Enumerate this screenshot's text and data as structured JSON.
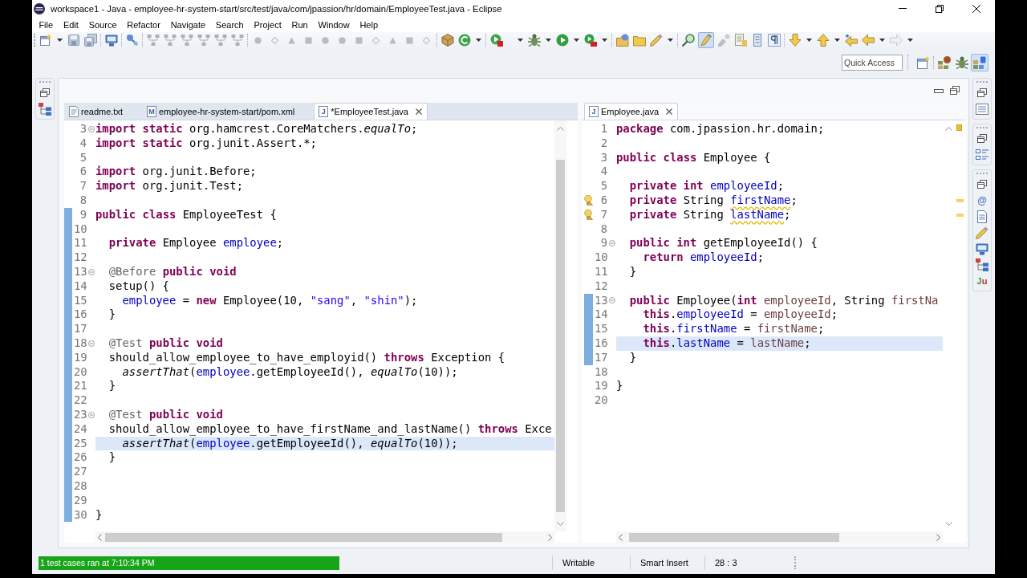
{
  "window": {
    "title": "workspace1 - Java - employee-hr-system-start/src/test/java/com/jpassion/hr/domain/EmployeeTest.java - Eclipse"
  },
  "menu": [
    "File",
    "Edit",
    "Source",
    "Refactor",
    "Navigate",
    "Search",
    "Project",
    "Run",
    "Window",
    "Help"
  ],
  "highlighter_button": {
    "on": true
  },
  "quick_access": {
    "placeholder": "Quick Access"
  },
  "perspectives": [
    {
      "selected": false
    },
    {
      "selected": false
    },
    {
      "selected": true
    }
  ],
  "view_glyphs": [
    "@",
    "Ju"
  ],
  "editors": [
    {
      "active": true,
      "tabs": [
        {
          "label": "readme.txt",
          "kind": "text",
          "selected": false
        },
        {
          "label": "employee-hr-system-start/pom.xml",
          "kind": "letter",
          "icon_letter": "M",
          "selected": false
        },
        {
          "label": "*EmployeeTest.java",
          "kind": "letter",
          "icon_letter": "J",
          "selected": true
        }
      ],
      "lines": [
        {
          "number": "3",
          "fold": true,
          "changed": false,
          "current": false,
          "warning": false,
          "tokens": [
            {
              "text": "import static",
              "kind": "keyword"
            },
            {
              "text": " org.hamcrest.CoreMatchers.",
              "kind": "plain"
            },
            {
              "text": "equalTo",
              "kind": "static"
            },
            {
              "text": ";",
              "kind": "plain"
            }
          ]
        },
        {
          "number": "4",
          "fold": false,
          "changed": false,
          "current": false,
          "warning": false,
          "tokens": [
            {
              "text": "import static",
              "kind": "keyword"
            },
            {
              "text": " org.junit.Assert.*;",
              "kind": "plain"
            }
          ]
        },
        {
          "number": "5",
          "fold": false,
          "changed": false,
          "current": false,
          "warning": false
        },
        {
          "number": "6",
          "fold": false,
          "changed": false,
          "current": false,
          "warning": false,
          "tokens": [
            {
              "text": "import",
              "kind": "keyword"
            },
            {
              "text": " org.junit.Before;",
              "kind": "plain"
            }
          ]
        },
        {
          "number": "7",
          "fold": false,
          "changed": false,
          "current": false,
          "warning": false,
          "tokens": [
            {
              "text": "import",
              "kind": "keyword"
            },
            {
              "text": " org.junit.Test;",
              "kind": "plain"
            }
          ]
        },
        {
          "number": "8",
          "fold": false,
          "changed": false,
          "current": false,
          "warning": false
        },
        {
          "number": "9",
          "fold": false,
          "changed": true,
          "current": false,
          "warning": false,
          "tokens": [
            {
              "text": "public class",
              "kind": "keyword"
            },
            {
              "text": " EmployeeTest {",
              "kind": "plain"
            }
          ]
        },
        {
          "number": "10",
          "fold": false,
          "changed": true,
          "current": false,
          "warning": false
        },
        {
          "number": "11",
          "fold": false,
          "changed": true,
          "current": false,
          "warning": false,
          "tokens": [
            {
              "text": "  private",
              "kind": "keyword"
            },
            {
              "text": " Employee ",
              "kind": "plain"
            },
            {
              "text": "employee",
              "kind": "field"
            },
            {
              "text": ";",
              "kind": "plain"
            }
          ]
        },
        {
          "number": "12",
          "fold": false,
          "changed": true,
          "current": false,
          "warning": false
        },
        {
          "number": "13",
          "fold": true,
          "changed": true,
          "current": false,
          "warning": false,
          "tokens": [
            {
              "text": "  @Before",
              "kind": "annotation"
            },
            {
              "text": " public void",
              "kind": "keyword"
            }
          ]
        },
        {
          "number": "14",
          "fold": false,
          "changed": true,
          "current": false,
          "warning": false,
          "tokens": [
            {
              "text": "  setup() {",
              "kind": "plain"
            }
          ]
        },
        {
          "number": "15",
          "fold": false,
          "changed": true,
          "current": false,
          "warning": false,
          "tokens": [
            {
              "text": "    employee",
              "kind": "field"
            },
            {
              "text": " = ",
              "kind": "plain"
            },
            {
              "text": "new",
              "kind": "keyword"
            },
            {
              "text": " Employee(10, ",
              "kind": "plain"
            },
            {
              "text": "\"sang\"",
              "kind": "string"
            },
            {
              "text": ", ",
              "kind": "plain"
            },
            {
              "text": "\"shin\"",
              "kind": "string"
            },
            {
              "text": ");",
              "kind": "plain"
            }
          ]
        },
        {
          "number": "16",
          "fold": false,
          "changed": true,
          "current": false,
          "warning": false,
          "tokens": [
            {
              "text": "  }",
              "kind": "plain"
            }
          ]
        },
        {
          "number": "17",
          "fold": false,
          "changed": true,
          "current": false,
          "warning": false
        },
        {
          "number": "18",
          "fold": true,
          "changed": true,
          "current": false,
          "warning": false,
          "tokens": [
            {
              "text": "  @Test",
              "kind": "annotation"
            },
            {
              "text": " public void",
              "kind": "keyword"
            }
          ]
        },
        {
          "number": "19",
          "fold": false,
          "changed": true,
          "current": false,
          "warning": false,
          "tokens": [
            {
              "text": "  should_allow_employee_to_have_employid() ",
              "kind": "plain"
            },
            {
              "text": "throws",
              "kind": "keyword"
            },
            {
              "text": " Exception {",
              "kind": "plain"
            }
          ]
        },
        {
          "number": "20",
          "fold": false,
          "changed": true,
          "current": false,
          "warning": false,
          "tokens": [
            {
              "text": "    assertThat",
              "kind": "static"
            },
            {
              "text": "(",
              "kind": "plain"
            },
            {
              "text": "employee",
              "kind": "field"
            },
            {
              "text": ".getEmployeeId(), ",
              "kind": "plain"
            },
            {
              "text": "equalTo",
              "kind": "static"
            },
            {
              "text": "(10));",
              "kind": "plain"
            }
          ]
        },
        {
          "number": "21",
          "fold": false,
          "changed": true,
          "current": false,
          "warning": false,
          "tokens": [
            {
              "text": "  }",
              "kind": "plain"
            }
          ]
        },
        {
          "number": "22",
          "fold": false,
          "changed": true,
          "current": false,
          "warning": false
        },
        {
          "number": "23",
          "fold": true,
          "changed": true,
          "current": false,
          "warning": false,
          "tokens": [
            {
              "text": "  @Test",
              "kind": "annotation"
            },
            {
              "text": " public void",
              "kind": "keyword"
            }
          ]
        },
        {
          "number": "24",
          "fold": false,
          "changed": true,
          "current": false,
          "warning": false,
          "tokens": [
            {
              "text": "  should_allow_employee_to_have_firstName_and_lastName() ",
              "kind": "plain"
            },
            {
              "text": "throws",
              "kind": "keyword"
            },
            {
              "text": " Exce",
              "kind": "plain"
            }
          ]
        },
        {
          "number": "25",
          "fold": false,
          "changed": true,
          "current": true,
          "warning": false,
          "tokens": [
            {
              "text": "    assertThat",
              "kind": "static"
            },
            {
              "text": "(",
              "kind": "plain"
            },
            {
              "text": "employee",
              "kind": "field"
            },
            {
              "text": ".getEmployeeId(), ",
              "kind": "plain"
            },
            {
              "text": "equalTo",
              "kind": "static"
            },
            {
              "text": "(10));",
              "kind": "plain"
            }
          ]
        },
        {
          "number": "26",
          "fold": false,
          "changed": true,
          "current": false,
          "warning": false,
          "tokens": [
            {
              "text": "  }",
              "kind": "plain"
            }
          ]
        },
        {
          "number": "27",
          "fold": false,
          "changed": true,
          "current": false,
          "warning": false
        },
        {
          "number": "28",
          "fold": false,
          "changed": true,
          "current": false,
          "warning": false
        },
        {
          "number": "29",
          "fold": false,
          "changed": true,
          "current": false,
          "warning": false
        },
        {
          "number": "30",
          "fold": false,
          "changed": true,
          "current": false,
          "warning": false,
          "tokens": [
            {
              "text": "}",
              "kind": "plain"
            }
          ]
        }
      ]
    },
    {
      "active": false,
      "tabs": [
        {
          "label": "Employee.java",
          "kind": "letter",
          "icon_letter": "J",
          "selected": true
        }
      ],
      "lines": [
        {
          "number": "1",
          "fold": false,
          "changed": false,
          "current": false,
          "warning": false,
          "tokens": [
            {
              "text": "package",
              "kind": "keyword"
            },
            {
              "text": " com.jpassion.hr.domain;",
              "kind": "plain"
            }
          ]
        },
        {
          "number": "2",
          "fold": false,
          "changed": false,
          "current": false,
          "warning": false
        },
        {
          "number": "3",
          "fold": false,
          "changed": false,
          "current": false,
          "warning": false,
          "tokens": [
            {
              "text": "public class",
              "kind": "keyword"
            },
            {
              "text": " Employee {",
              "kind": "plain"
            }
          ]
        },
        {
          "number": "4",
          "fold": false,
          "changed": false,
          "current": false,
          "warning": false
        },
        {
          "number": "5",
          "fold": false,
          "changed": false,
          "current": false,
          "warning": false,
          "tokens": [
            {
              "text": "  private int",
              "kind": "keyword"
            },
            {
              "text": " employeeId",
              "kind": "field"
            },
            {
              "text": ";",
              "kind": "plain"
            }
          ]
        },
        {
          "number": "6",
          "fold": false,
          "changed": false,
          "current": false,
          "warning": true,
          "tokens": [
            {
              "text": "  private",
              "kind": "keyword"
            },
            {
              "text": " String ",
              "kind": "plain"
            },
            {
              "text": "firstName",
              "kind": "warned-field"
            },
            {
              "text": ";",
              "kind": "plain"
            }
          ]
        },
        {
          "number": "7",
          "fold": false,
          "changed": false,
          "current": false,
          "warning": true,
          "tokens": [
            {
              "text": "  private",
              "kind": "keyword"
            },
            {
              "text": " String ",
              "kind": "plain"
            },
            {
              "text": "lastName",
              "kind": "warned-field"
            },
            {
              "text": ";",
              "kind": "plain"
            }
          ]
        },
        {
          "number": "8",
          "fold": false,
          "changed": false,
          "current": false,
          "warning": false
        },
        {
          "number": "9",
          "fold": true,
          "changed": false,
          "current": false,
          "warning": false,
          "tokens": [
            {
              "text": "  public int",
              "kind": "keyword"
            },
            {
              "text": " getEmployeeId() {",
              "kind": "plain"
            }
          ]
        },
        {
          "number": "10",
          "fold": false,
          "changed": false,
          "current": false,
          "warning": false,
          "tokens": [
            {
              "text": "    return",
              "kind": "keyword"
            },
            {
              "text": " employeeId",
              "kind": "field"
            },
            {
              "text": ";",
              "kind": "plain"
            }
          ]
        },
        {
          "number": "11",
          "fold": false,
          "changed": false,
          "current": false,
          "warning": false,
          "tokens": [
            {
              "text": "  }",
              "kind": "plain"
            }
          ]
        },
        {
          "number": "12",
          "fold": false,
          "changed": false,
          "current": false,
          "warning": false
        },
        {
          "number": "13",
          "fold": true,
          "changed": true,
          "current": false,
          "warning": false,
          "tokens": [
            {
              "text": "  public",
              "kind": "keyword"
            },
            {
              "text": " Employee(",
              "kind": "plain"
            },
            {
              "text": "int",
              "kind": "keyword"
            },
            {
              "text": " employeeId",
              "kind": "param"
            },
            {
              "text": ", String ",
              "kind": "plain"
            },
            {
              "text": "firstNa",
              "kind": "param"
            }
          ]
        },
        {
          "number": "14",
          "fold": false,
          "changed": true,
          "current": false,
          "warning": false,
          "tokens": [
            {
              "text": "    this",
              "kind": "keyword"
            },
            {
              "text": ".",
              "kind": "plain"
            },
            {
              "text": "employeeId",
              "kind": "field"
            },
            {
              "text": " = ",
              "kind": "plain"
            },
            {
              "text": "employeeId",
              "kind": "param"
            },
            {
              "text": ";",
              "kind": "plain"
            }
          ]
        },
        {
          "number": "15",
          "fold": false,
          "changed": true,
          "current": false,
          "warning": false,
          "tokens": [
            {
              "text": "    this",
              "kind": "keyword"
            },
            {
              "text": ".",
              "kind": "plain"
            },
            {
              "text": "firstName",
              "kind": "field"
            },
            {
              "text": " = ",
              "kind": "plain"
            },
            {
              "text": "firstName",
              "kind": "param"
            },
            {
              "text": ";",
              "kind": "plain"
            }
          ]
        },
        {
          "number": "16",
          "fold": false,
          "changed": true,
          "current": true,
          "warning": false,
          "tokens": [
            {
              "text": "    this",
              "kind": "keyword"
            },
            {
              "text": ".",
              "kind": "plain"
            },
            {
              "text": "lastName",
              "kind": "field"
            },
            {
              "text": " = ",
              "kind": "plain"
            },
            {
              "text": "lastName",
              "kind": "param"
            },
            {
              "text": ";",
              "kind": "plain"
            }
          ]
        },
        {
          "number": "17",
          "fold": false,
          "changed": true,
          "current": false,
          "warning": false,
          "tokens": [
            {
              "text": "  }",
              "kind": "plain"
            }
          ]
        },
        {
          "number": "18",
          "fold": false,
          "changed": false,
          "current": false,
          "warning": false
        },
        {
          "number": "19",
          "fold": false,
          "changed": false,
          "current": false,
          "warning": false,
          "tokens": [
            {
              "text": "}",
              "kind": "plain"
            }
          ]
        },
        {
          "number": "20",
          "fold": false,
          "changed": false,
          "current": false,
          "warning": false
        }
      ]
    }
  ],
  "status_bar": {
    "message": "1 test cases ran at 7:10:34 PM",
    "fields": [
      "Writable",
      "Smart Insert",
      "28 : 3"
    ]
  }
}
